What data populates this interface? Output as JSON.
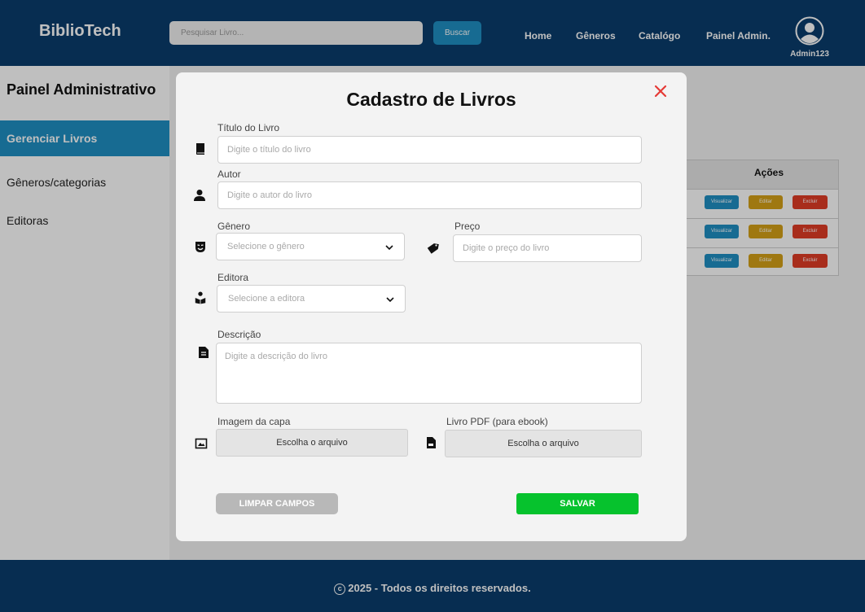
{
  "header": {
    "logo": "BiblioTech",
    "search_placeholder": "Pesquisar Livro...",
    "search_button": "Buscar",
    "nav": [
      "Home",
      "Gêneros",
      "Catalógo",
      "Painel Admin."
    ],
    "user": "Admin123"
  },
  "sidebar": {
    "title": "Painel Administrativo",
    "items": [
      {
        "label": "Gerenciar Livros",
        "active": true
      },
      {
        "label": "Gêneros/categorias",
        "active": false
      },
      {
        "label": "Editoras",
        "active": false
      }
    ]
  },
  "background_table": {
    "header": "Ações",
    "actions": [
      "Visualizar",
      "Editar",
      "Excluir"
    ],
    "row_count": 3
  },
  "modal": {
    "title": "Cadastro de Livros",
    "fields": {
      "titulo": {
        "label": "Título do Livro",
        "placeholder": "Digite o título do livro"
      },
      "autor": {
        "label": "Autor",
        "placeholder": "Digite o autor do livro"
      },
      "genero": {
        "label": "Gênero",
        "placeholder": "Selecione o gênero"
      },
      "preco": {
        "label": "Preço",
        "placeholder": "Digite o preço do livro"
      },
      "editora": {
        "label": "Editora",
        "placeholder": "Selecione a editora"
      },
      "descricao": {
        "label": "Descrição",
        "placeholder": "Digite a descrição do livro"
      },
      "capa": {
        "label": "Imagem da capa",
        "button": "Escolha o arquivo"
      },
      "pdf": {
        "label": "Livro PDF (para ebook)",
        "button": "Escolha o arquivo"
      }
    },
    "clear_button": "LIMPAR CAMPOS",
    "save_button": "SALVAR"
  },
  "footer": {
    "copyright_symbol": "c",
    "text": "2025 - Todos os direitos reservados."
  },
  "colors": {
    "header_bg": "#0a3d6d",
    "accent_blue": "#1f8fc3",
    "save_green": "#06c22d",
    "close_red": "#e53935",
    "edit_yellow": "#d4a017",
    "delete_red": "#e03c26"
  }
}
